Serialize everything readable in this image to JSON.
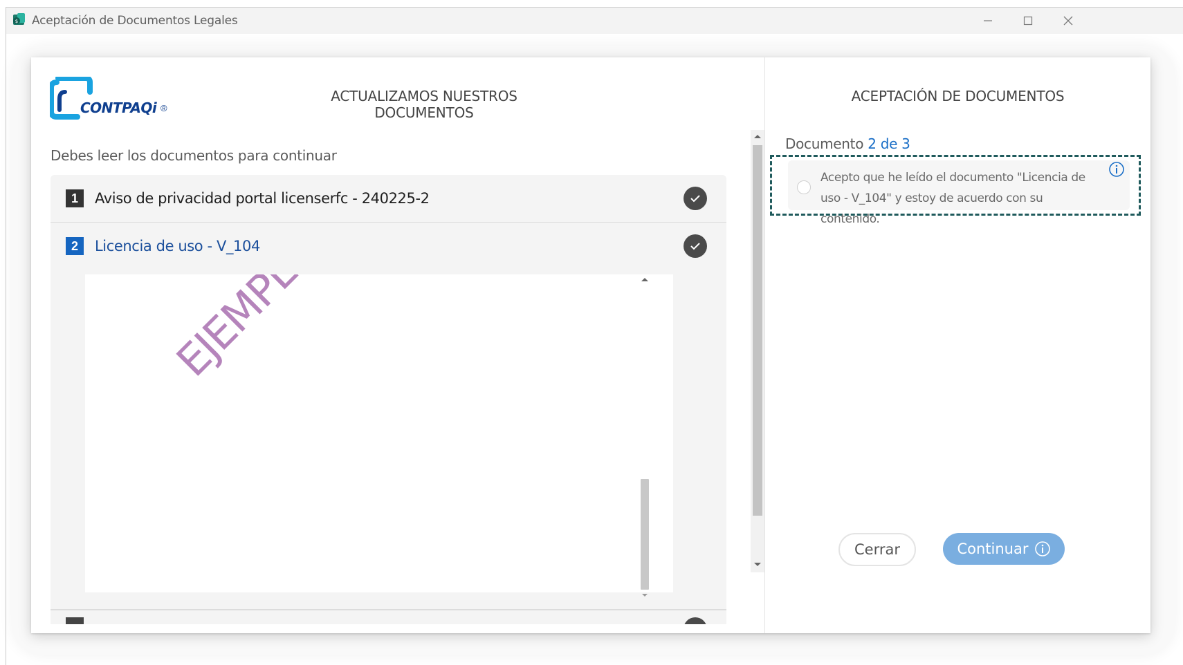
{
  "window": {
    "title": "Aceptación de Documentos Legales",
    "controls": [
      "minimize-icon",
      "maximize-icon",
      "close-icon"
    ]
  },
  "logo": {
    "brand_text": "CONTPAQi",
    "registered": "®"
  },
  "left": {
    "heading": "ACTUALIZAMOS NUESTROS DOCUMENTOS",
    "instruction": "Debes leer los documentos para continuar",
    "documents": [
      {
        "number": "1",
        "title": "Aviso de privacidad portal licenserfc - 240225-2",
        "read": true,
        "expanded": false
      },
      {
        "number": "2",
        "title": "Licencia de uso - V_104",
        "read": true,
        "expanded": true
      }
    ],
    "viewer_watermark": "EJEMPLO D"
  },
  "right": {
    "heading": "ACEPTACIÓN DE DOCUMENTOS",
    "counter_prefix": "Documento",
    "counter_value": "2 de 3",
    "accept_text": "Acepto que he leído el documento \"Licencia de uso - V_104\" y estoy de acuerdo con su contenido.",
    "accepted": false,
    "buttons": {
      "close": "Cerrar",
      "continue": "Continuar"
    }
  },
  "colors": {
    "accent": "#1b6fc7",
    "badge_active": "#1565c0",
    "badge_inactive": "#333333",
    "continue_disabled": "#7aaee0",
    "focus_border": "#1f5a5c",
    "watermark": "#a96fb0"
  }
}
